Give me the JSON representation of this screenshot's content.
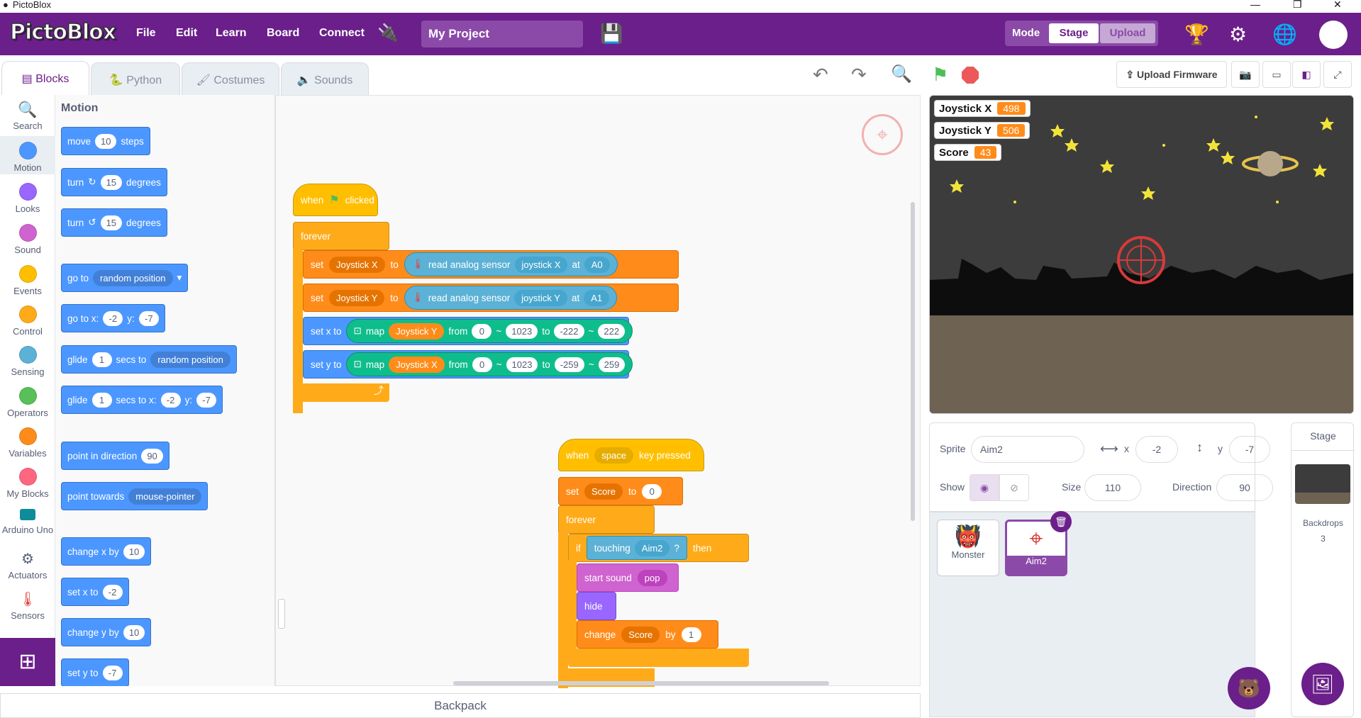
{
  "window": {
    "title": "PictoBlox"
  },
  "menubar": {
    "logo": "PictoBlox",
    "items": [
      "File",
      "Edit",
      "Learn",
      "Board",
      "Connect"
    ],
    "project_name": "My Project",
    "mode_label": "Mode",
    "mode_stage": "Stage",
    "mode_upload": "Upload"
  },
  "tabs": [
    "Blocks",
    "Python",
    "Costumes",
    "Sounds"
  ],
  "categories": [
    {
      "name": "Search",
      "color": "#4c97ff"
    },
    {
      "name": "Motion",
      "color": "#4c97ff"
    },
    {
      "name": "Looks",
      "color": "#9966ff"
    },
    {
      "name": "Sound",
      "color": "#cf63cf"
    },
    {
      "name": "Events",
      "color": "#ffbf00"
    },
    {
      "name": "Control",
      "color": "#ffab19"
    },
    {
      "name": "Sensing",
      "color": "#5cb1d6"
    },
    {
      "name": "Operators",
      "color": "#59c059"
    },
    {
      "name": "Variables",
      "color": "#ff8c1a"
    },
    {
      "name": "My Blocks",
      "color": "#ff6680"
    },
    {
      "name": "Arduino Uno",
      "color": "#0fbd8c"
    },
    {
      "name": "Actuators",
      "color": "#ffd500"
    },
    {
      "name": "Sensors",
      "color": "#e0403b"
    }
  ],
  "palette": {
    "heading": "Motion",
    "move": [
      "move",
      "10",
      "steps"
    ],
    "turn_right": [
      "turn",
      "15",
      "degrees"
    ],
    "turn_left": [
      "turn",
      "15",
      "degrees"
    ],
    "goto": [
      "go to",
      "random position"
    ],
    "goto_xy": [
      "go to x:",
      "-2",
      "y:",
      "-7"
    ],
    "glide_to": [
      "glide",
      "1",
      "secs to",
      "random position"
    ],
    "glide_xy": [
      "glide",
      "1",
      "secs to x:",
      "-2",
      "y:",
      "-7"
    ],
    "point_dir": [
      "point in direction",
      "90"
    ],
    "point_towards": [
      "point towards",
      "mouse-pointer"
    ],
    "change_x": [
      "change x by",
      "10"
    ],
    "set_x": [
      "set x to",
      "-2"
    ],
    "change_y": [
      "change y by",
      "10"
    ],
    "set_y": [
      "set y to",
      "-7"
    ]
  },
  "script1": {
    "hat": [
      "when",
      "clicked"
    ],
    "forever": "forever",
    "set1": [
      "set",
      "Joystick X",
      "to",
      "read analog sensor",
      "joystick X",
      "at",
      "A0"
    ],
    "set2": [
      "set",
      "Joystick Y",
      "to",
      "read analog sensor",
      "joystick Y",
      "at",
      "A1"
    ],
    "setx": [
      "set x to",
      "map",
      "Joystick Y",
      "from",
      "0",
      "~",
      "1023",
      "to",
      "-222",
      "~",
      "222"
    ],
    "sety": [
      "set y to",
      "map",
      "Joystick X",
      "from",
      "0",
      "~",
      "1023",
      "to",
      "-259",
      "~",
      "259"
    ]
  },
  "script2": {
    "hat": [
      "when",
      "space",
      "key pressed"
    ],
    "set": [
      "set",
      "Score",
      "to",
      "0"
    ],
    "forever": "forever",
    "if": [
      "if",
      "touching",
      "Aim2",
      "?",
      "then"
    ],
    "sound": [
      "start sound",
      "pop"
    ],
    "hide": "hide",
    "change": [
      "change",
      "Score",
      "by",
      "1"
    ]
  },
  "backpack": "Backpack",
  "stage_toolbar": {
    "upload_firmware": "Upload Firmware"
  },
  "monitors": [
    {
      "label": "Joystick X",
      "value": "498"
    },
    {
      "label": "Joystick Y",
      "value": "506"
    },
    {
      "label": "Score",
      "value": "43"
    }
  ],
  "sprite_info": {
    "sprite_label": "Sprite",
    "sprite_name": "Aim2",
    "x_label": "x",
    "x": "-2",
    "y_label": "y",
    "y": "-7",
    "show_label": "Show",
    "size_label": "Size",
    "size": "110",
    "direction_label": "Direction",
    "direction": "90"
  },
  "sprites": [
    {
      "name": "Monster"
    },
    {
      "name": "Aim2"
    }
  ],
  "stage_panel": {
    "title": "Stage",
    "backdrops_label": "Backdrops",
    "backdrops_count": "3"
  }
}
